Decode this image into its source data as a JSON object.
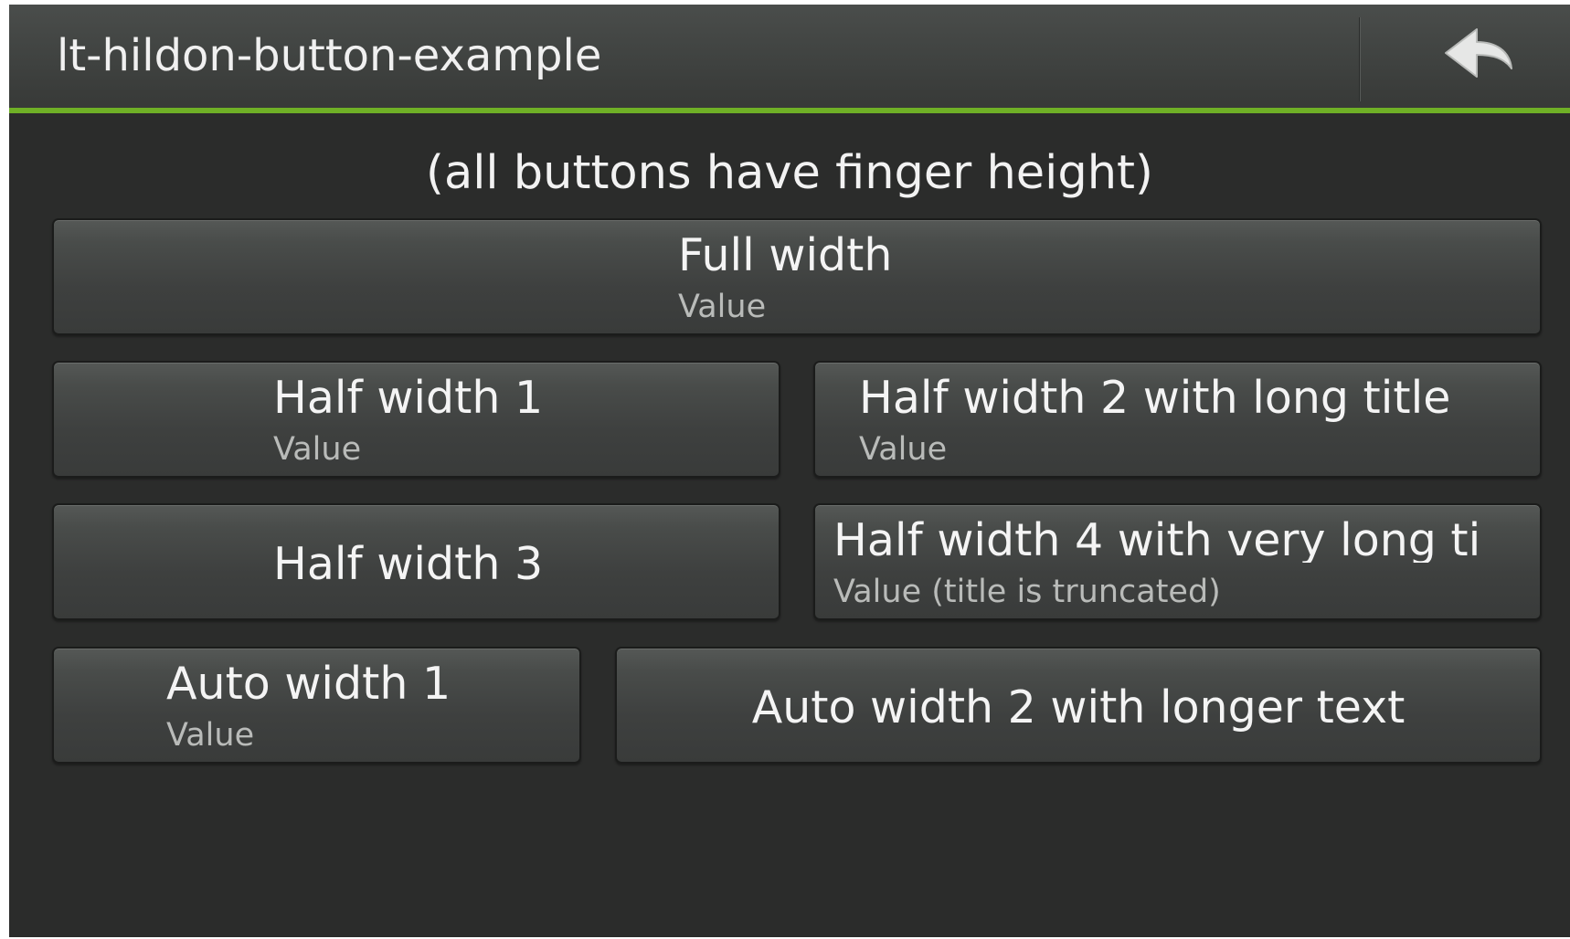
{
  "window": {
    "title": "lt-hildon-button-example"
  },
  "icons": {
    "back": "back-arrow-icon"
  },
  "colors": {
    "accent": "#6fb026",
    "background": "#2b2c2b",
    "title_bar": "#414442",
    "button_text": "#f4f4f4",
    "value_text": "#b9bbb9"
  },
  "content": {
    "subtitle": "(all buttons have finger height)",
    "buttons": [
      {
        "title": "Full width",
        "value": "Value"
      },
      {
        "title": "Half width 1",
        "value": "Value"
      },
      {
        "title": "Half width 2 with long title",
        "value": "Value"
      },
      {
        "title": "Half width 3",
        "value": ""
      },
      {
        "title": "Half width 4 with very long ti",
        "value": "Value (title is truncated)"
      },
      {
        "title": "Auto width 1",
        "value": "Value"
      },
      {
        "title": "Auto width 2 with longer text",
        "value": ""
      }
    ]
  }
}
